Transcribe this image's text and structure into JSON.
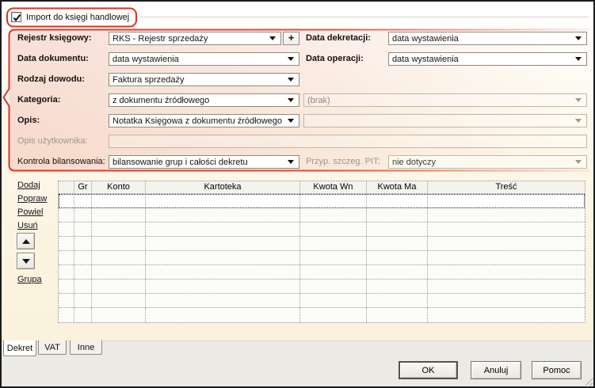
{
  "colors": {
    "annotation_red": "#dc3326",
    "form_tint_pink": "#f7e2db",
    "page_cream": "#fbf4e0",
    "panel_gray": "#eceae4"
  },
  "header": {
    "import_checkbox": {
      "label": "Import do księgi handlowej",
      "checked": true
    }
  },
  "form": {
    "register_row": {
      "label": "Rejestr księgowy:",
      "value": "RKS - Rejestr sprzedaży",
      "add_button_label": "+"
    },
    "document_date_row": {
      "label": "Data dokumentu:",
      "value": "data wystawienia"
    },
    "evidence_type_row": {
      "label": "Rodzaj dowodu:",
      "value": "Faktura sprzedaży"
    },
    "category_row": {
      "label": "Kategoria:",
      "value": "z dokumentu źródłowego",
      "secondary_value": "(brak)"
    },
    "description_row": {
      "label": "Opis:",
      "value": "Notatka Księgowa z dokumentu źródłowego",
      "secondary_value": ""
    },
    "user_description_row": {
      "label": "Opis użytkownika:",
      "value": ""
    },
    "balance_control_row": {
      "label": "Kontrola bilansowania:",
      "value": "bilansowanie grup i całości dekretu"
    },
    "decree_date_row": {
      "label": "Data dekretacji:",
      "value": "data wystawienia"
    },
    "operation_date_row": {
      "label": "Data operacji:",
      "value": "data wystawienia"
    },
    "pit_row": {
      "label": "Przyp. szczeg. PIT:",
      "value": "nie dotyczy"
    }
  },
  "actions": {
    "add": "Dodaj",
    "edit": "Popraw",
    "duplicate": "Powiel",
    "delete": "Usuń",
    "group": "Grupa"
  },
  "table": {
    "columns": [
      "",
      "Gr",
      "Konto",
      "Kartoteka",
      "Kwota Wn",
      "Kwota Ma",
      "Treść"
    ],
    "row_count": 9,
    "selected_row_index": 0
  },
  "tabs": [
    {
      "label": "Dekret",
      "active": true
    },
    {
      "label": "VAT",
      "active": false
    },
    {
      "label": "Inne",
      "active": false
    }
  ],
  "footer": {
    "ok": "OK",
    "cancel": "Anuluj",
    "help": "Pomoc"
  }
}
